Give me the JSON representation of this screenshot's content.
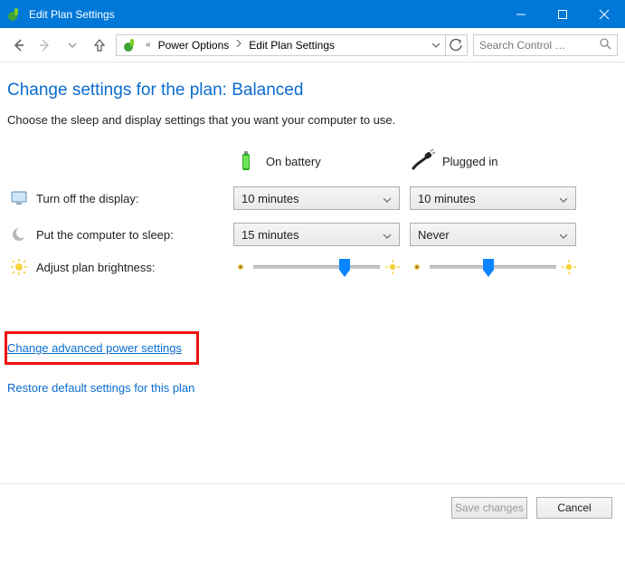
{
  "window": {
    "title": "Edit Plan Settings"
  },
  "breadcrumb": {
    "root": "Power Options",
    "current": "Edit Plan Settings"
  },
  "search": {
    "placeholder": "Search Control …"
  },
  "page": {
    "heading": "Change settings for the plan: Balanced",
    "subheading": "Choose the sleep and display settings that you want your computer to use."
  },
  "columns": {
    "battery": "On battery",
    "plugged": "Plugged in"
  },
  "rows": {
    "display_off": {
      "label": "Turn off the display:",
      "battery_value": "10 minutes",
      "plugged_value": "10 minutes"
    },
    "sleep": {
      "label": "Put the computer to sleep:",
      "battery_value": "15 minutes",
      "plugged_value": "Never"
    },
    "brightness": {
      "label": "Adjust plan brightness:",
      "battery_pct": 78,
      "plugged_pct": 50
    }
  },
  "links": {
    "advanced": "Change advanced power settings",
    "restore": "Restore default settings for this plan"
  },
  "buttons": {
    "save": "Save changes",
    "cancel": "Cancel"
  }
}
